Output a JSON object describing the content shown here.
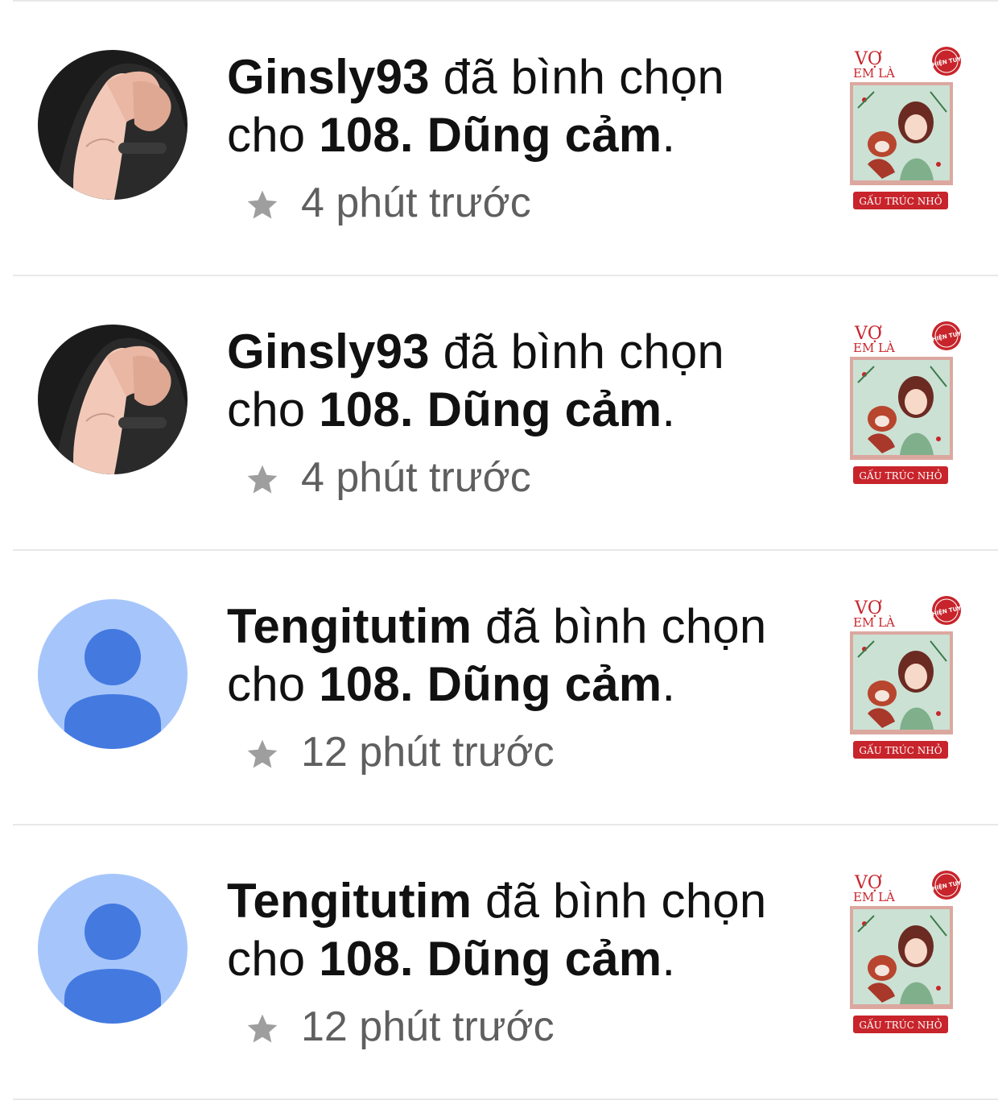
{
  "notifications": [
    {
      "username": "Ginsly93",
      "action": "đã bình chọn",
      "preposition": "cho",
      "chapter": "108. Dũng cảm",
      "period": ".",
      "time": "4 phút trước",
      "avatar": "photo-avatar",
      "cover": {
        "title_line1": "VỢ",
        "title_line2": "EM LÀ",
        "badge": "HIỆN TUY",
        "author": "GẤU TRÚC NHỎ"
      }
    },
    {
      "username": "Ginsly93",
      "action": "đã bình chọn",
      "preposition": "cho",
      "chapter": "108. Dũng cảm",
      "period": ".",
      "time": "4 phút trước",
      "avatar": "photo-avatar",
      "cover": {
        "title_line1": "VỢ",
        "title_line2": "EM LÀ",
        "badge": "HIỆN TUY",
        "author": "GẤU TRÚC NHỎ"
      }
    },
    {
      "username": "Tengitutim",
      "action": "đã bình chọn",
      "preposition": "cho",
      "chapter": "108. Dũng cảm",
      "period": ".",
      "time": "12 phút trước",
      "avatar": "default-person-avatar",
      "cover": {
        "title_line1": "VỢ",
        "title_line2": "EM LÀ",
        "badge": "HIỆN TUY",
        "author": "GẤU TRÚC NHỎ"
      }
    },
    {
      "username": "Tengitutim",
      "action": "đã bình chọn",
      "preposition": "cho",
      "chapter": "108. Dũng cảm",
      "period": ".",
      "time": "12 phút trước",
      "avatar": "default-person-avatar",
      "cover": {
        "title_line1": "VỢ",
        "title_line2": "EM LÀ",
        "badge": "HIỆN TUY",
        "author": "GẤU TRÚC NHỎ"
      }
    }
  ],
  "icons": {
    "time_icon": "star-icon"
  },
  "colors": {
    "star": "#9e9e9e",
    "meta_text": "#5f5f5f",
    "default_avatar_bg": "#a6c6fb",
    "default_avatar_fg": "#4479e0",
    "cover_red": "#c8242b",
    "divider": "#e8e8e8"
  }
}
